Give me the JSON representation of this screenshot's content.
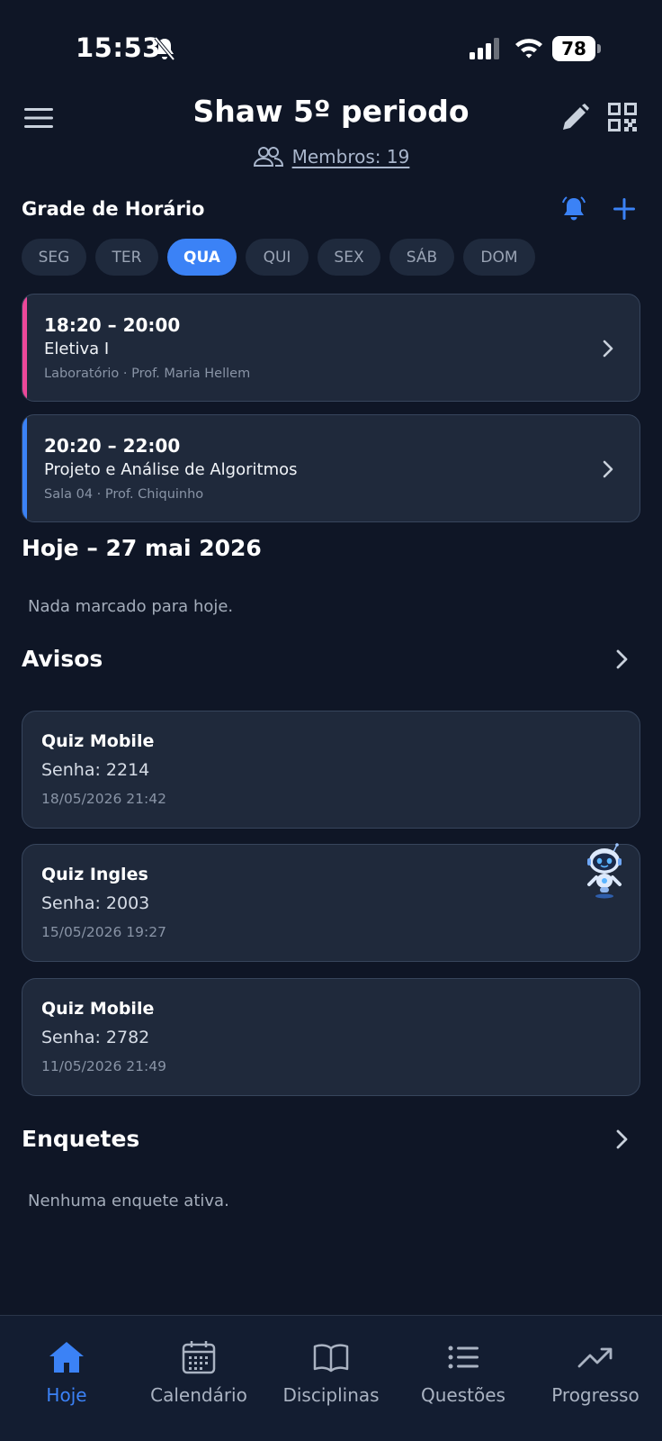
{
  "status_bar": {
    "time": "15:53",
    "battery": "78"
  },
  "header": {
    "title": "Shaw 5º periodo",
    "members_label": "Membros: 19"
  },
  "schedule": {
    "title": "Grade de Horário",
    "days": [
      "SEG",
      "TER",
      "QUA",
      "QUI",
      "SEX",
      "SÁB",
      "DOM"
    ],
    "active_day": "QUA",
    "classes": [
      {
        "time": "18:20 – 20:00",
        "name": "Eletiva I",
        "meta": "Laboratório · Prof. Maria Hellem",
        "accent_color": "#ec4899"
      },
      {
        "time": "20:20 – 22:00",
        "name": "Projeto e Análise de Algoritmos",
        "meta": "Sala 04 · Prof. Chiquinho",
        "accent_color": "#3b82f6"
      }
    ]
  },
  "today": {
    "title": "Hoje – 27 mai 2026",
    "empty_text": "Nada marcado para hoje."
  },
  "notices": {
    "title": "Avisos",
    "items": [
      {
        "title": "Quiz Mobile",
        "body": "Senha: 2214",
        "date": "18/05/2026 21:42"
      },
      {
        "title": "Quiz Ingles",
        "body": "Senha: 2003",
        "date": "15/05/2026 19:27"
      },
      {
        "title": "Quiz Mobile",
        "body": "Senha: 2782",
        "date": "11/05/2026 21:49"
      }
    ]
  },
  "polls": {
    "title": "Enquetes",
    "empty_text": "Nenhuma enquete ativa."
  },
  "nav": {
    "items": [
      {
        "label": "Hoje",
        "icon": "home-icon"
      },
      {
        "label": "Calendário",
        "icon": "calendar-icon"
      },
      {
        "label": "Disciplinas",
        "icon": "book-icon"
      },
      {
        "label": "Questões",
        "icon": "list-icon"
      },
      {
        "label": "Progresso",
        "icon": "trend-icon"
      }
    ],
    "active": "Hoje"
  },
  "colors": {
    "accent": "#3b82f6",
    "background": "#0f1626",
    "card": "#1f293b"
  }
}
